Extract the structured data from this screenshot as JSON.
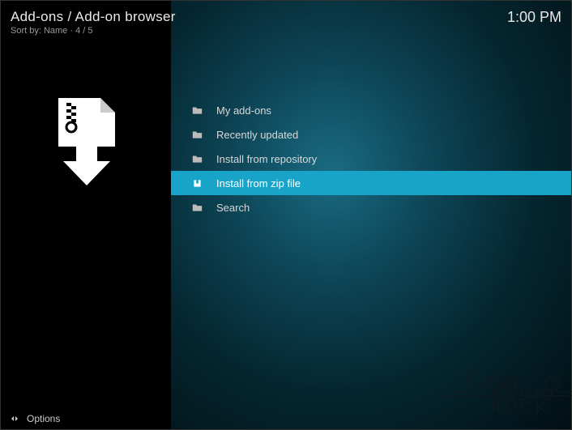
{
  "header": {
    "title": "Add-ons / Add-on browser",
    "subtitle": "Sort by: Name  ·  4 / 5",
    "clock": "1:00 PM"
  },
  "menu": {
    "items": [
      {
        "label": "My add-ons",
        "icon": "folder",
        "selected": false
      },
      {
        "label": "Recently updated",
        "icon": "folder",
        "selected": false
      },
      {
        "label": "Install from repository",
        "icon": "folder",
        "selected": false
      },
      {
        "label": "Install from zip file",
        "icon": "box",
        "selected": true
      },
      {
        "label": "Search",
        "icon": "folder",
        "selected": false
      }
    ]
  },
  "footer": {
    "options": "Options"
  },
  "watermark": {
    "line1": "Cesar",
    "line2": "RADIO",
    "line3": "ROCK"
  }
}
